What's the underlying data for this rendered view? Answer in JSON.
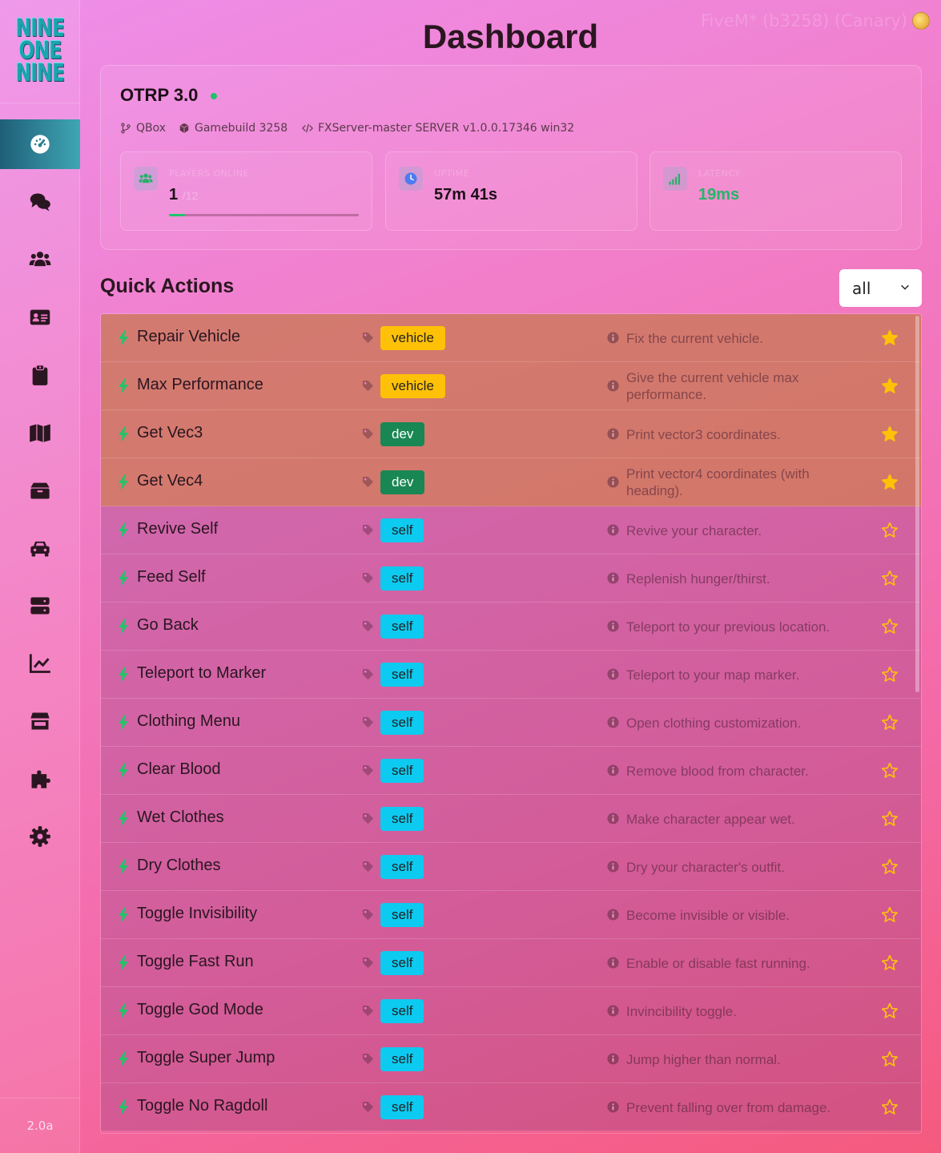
{
  "app": {
    "logo_lines": [
      "NINE",
      "ONE",
      "NINE"
    ],
    "version": "2.0a",
    "build_info": "FiveM* (b3258) (Canary)"
  },
  "sidebar": {
    "items": [
      {
        "name": "dashboard",
        "icon": "gauge-icon",
        "active": true
      },
      {
        "name": "chat",
        "icon": "chat-bubbles-icon",
        "active": false
      },
      {
        "name": "players",
        "icon": "users-icon",
        "active": false
      },
      {
        "name": "id-card",
        "icon": "id-card-icon",
        "active": false
      },
      {
        "name": "clipboard",
        "icon": "clipboard-icon",
        "active": false
      },
      {
        "name": "map",
        "icon": "map-icon",
        "active": false
      },
      {
        "name": "inventory",
        "icon": "box-icon",
        "active": false
      },
      {
        "name": "vehicles",
        "icon": "car-icon",
        "active": false
      },
      {
        "name": "server",
        "icon": "server-icon",
        "active": false
      },
      {
        "name": "stats",
        "icon": "chart-line-icon",
        "active": false
      },
      {
        "name": "store",
        "icon": "store-icon",
        "active": false
      },
      {
        "name": "plugins",
        "icon": "puzzle-icon",
        "active": false
      },
      {
        "name": "settings",
        "icon": "gear-icon",
        "active": false
      }
    ]
  },
  "header": {
    "title": "Dashboard"
  },
  "server": {
    "name": "OTRP 3.0",
    "framework": "QBox",
    "gamebuild": "Gamebuild 3258",
    "fxserver": "FXServer-master SERVER v1.0.0.17346 win32",
    "stats": {
      "players": {
        "label": "PLAYERS ONLINE",
        "value": "1",
        "max": "/12",
        "fraction": 0.083
      },
      "uptime": {
        "label": "UPTIME",
        "value": "57m 41s"
      },
      "latency": {
        "label": "LATENCY",
        "value": "19ms"
      }
    }
  },
  "quick_actions": {
    "title": "Quick Actions",
    "filter": {
      "selected": "all"
    },
    "items": [
      {
        "label": "Repair Vehicle",
        "tag": "vehicle",
        "desc": "Fix the current vehicle.",
        "favorite": true
      },
      {
        "label": "Max Performance",
        "tag": "vehicle",
        "desc": "Give the current vehicle max performance.",
        "favorite": true
      },
      {
        "label": "Get Vec3",
        "tag": "dev",
        "desc": "Print vector3 coordinates.",
        "favorite": true
      },
      {
        "label": "Get Vec4",
        "tag": "dev",
        "desc": "Print vector4 coordinates (with heading).",
        "favorite": true
      },
      {
        "label": "Revive Self",
        "tag": "self",
        "desc": "Revive your character.",
        "favorite": false
      },
      {
        "label": "Feed Self",
        "tag": "self",
        "desc": "Replenish hunger/thirst.",
        "favorite": false
      },
      {
        "label": "Go Back",
        "tag": "self",
        "desc": "Teleport to your previous location.",
        "favorite": false
      },
      {
        "label": "Teleport to Marker",
        "tag": "self",
        "desc": "Teleport to your map marker.",
        "favorite": false
      },
      {
        "label": "Clothing Menu",
        "tag": "self",
        "desc": "Open clothing customization.",
        "favorite": false
      },
      {
        "label": "Clear Blood",
        "tag": "self",
        "desc": "Remove blood from character.",
        "favorite": false
      },
      {
        "label": "Wet Clothes",
        "tag": "self",
        "desc": "Make character appear wet.",
        "favorite": false
      },
      {
        "label": "Dry Clothes",
        "tag": "self",
        "desc": "Dry your character's outfit.",
        "favorite": false
      },
      {
        "label": "Toggle Invisibility",
        "tag": "self",
        "desc": "Become invisible or visible.",
        "favorite": false
      },
      {
        "label": "Toggle Fast Run",
        "tag": "self",
        "desc": "Enable or disable fast running.",
        "favorite": false
      },
      {
        "label": "Toggle God Mode",
        "tag": "self",
        "desc": "Invincibility toggle.",
        "favorite": false
      },
      {
        "label": "Toggle Super Jump",
        "tag": "self",
        "desc": "Jump higher than normal.",
        "favorite": false
      },
      {
        "label": "Toggle No Ragdoll",
        "tag": "self",
        "desc": "Prevent falling over from damage.",
        "favorite": false
      }
    ]
  },
  "colors": {
    "accent_teal": "#1aa5b0",
    "online_green": "#22c46a",
    "badge_vehicle": "#ffc107",
    "badge_dev": "#198754",
    "badge_self": "#0dcaf0",
    "star": "#ffc107"
  }
}
